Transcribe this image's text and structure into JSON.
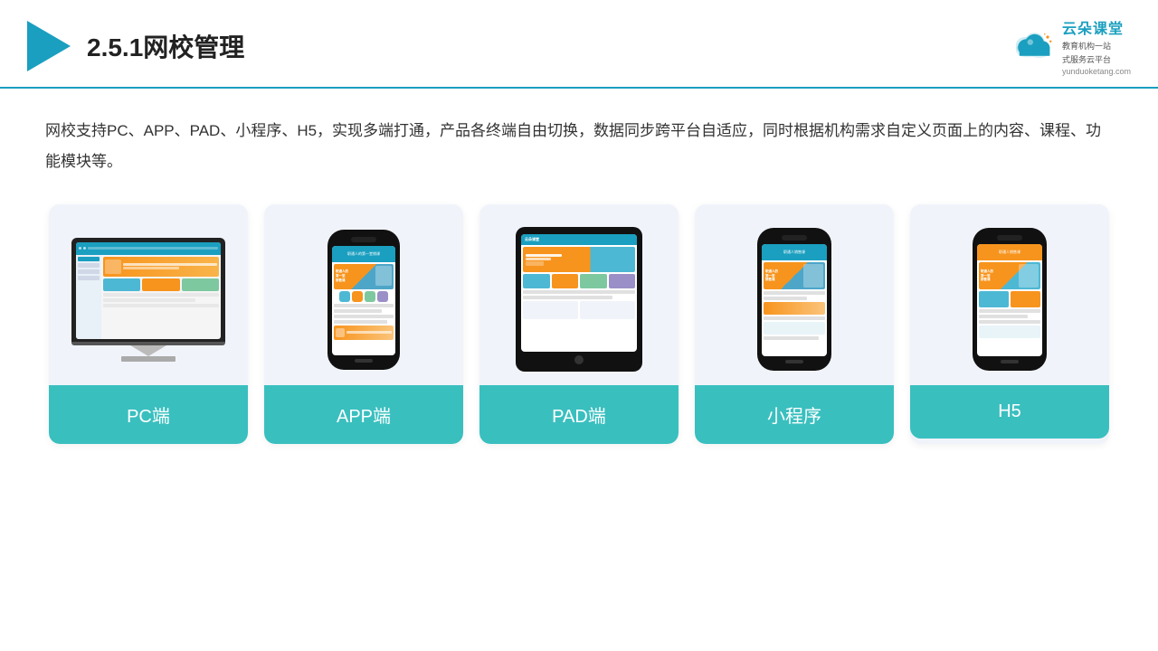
{
  "header": {
    "title": "2.5.1网校管理",
    "brand": {
      "name": "云朵课堂",
      "sub1": "教育机构一站",
      "sub2": "式服务云平台",
      "url": "yunduoketang.com"
    }
  },
  "description": "网校支持PC、APP、PAD、小程序、H5，实现多端打通，产品各终端自由切换，数据同步跨平台自适应，同时根据机构需求自定义页面上的内容、课程、功能模块等。",
  "cards": [
    {
      "id": "pc",
      "label": "PC端"
    },
    {
      "id": "app",
      "label": "APP端"
    },
    {
      "id": "pad",
      "label": "PAD端"
    },
    {
      "id": "miniprogram",
      "label": "小程序"
    },
    {
      "id": "h5",
      "label": "H5"
    }
  ],
  "colors": {
    "teal": "#3abfbf",
    "accent": "#1a9fc0",
    "orange": "#f7941d"
  }
}
